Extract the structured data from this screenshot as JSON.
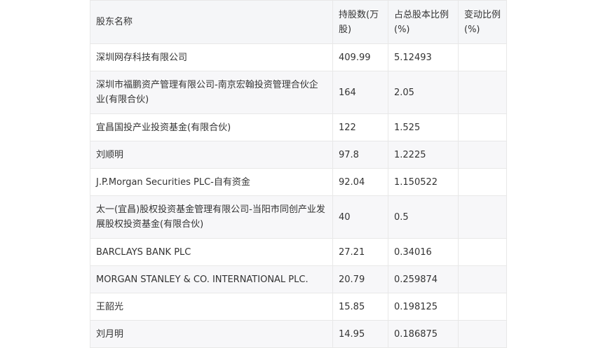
{
  "table": {
    "headers": [
      "股东名称",
      "持股数(万股)",
      "占总股本比例(%)",
      "变动比例(%)"
    ],
    "rows": [
      {
        "name": "深圳网存科技有限公司",
        "shares": "409.99",
        "ratio": "5.12493",
        "change": ""
      },
      {
        "name": "深圳市福鹏资产管理有限公司-南京宏翰投资管理合伙企业(有限合伙)",
        "shares": "164",
        "ratio": "2.05",
        "change": ""
      },
      {
        "name": "宜昌国投产业投资基金(有限合伙)",
        "shares": "122",
        "ratio": "1.525",
        "change": ""
      },
      {
        "name": "刘顺明",
        "shares": "97.8",
        "ratio": "1.2225",
        "change": ""
      },
      {
        "name": "J.P.Morgan Securities PLC-自有资金",
        "shares": "92.04",
        "ratio": "1.150522",
        "change": ""
      },
      {
        "name": "太一(宜昌)股权投资基金管理有限公司-当阳市同创产业发展股权投资基金(有限合伙)",
        "shares": "40",
        "ratio": "0.5",
        "change": ""
      },
      {
        "name": "BARCLAYS BANK PLC",
        "shares": "27.21",
        "ratio": "0.34016",
        "change": ""
      },
      {
        "name": "MORGAN STANLEY & CO. INTERNATIONAL PLC.",
        "shares": "20.79",
        "ratio": "0.259874",
        "change": ""
      },
      {
        "name": "王韶光",
        "shares": "15.85",
        "ratio": "0.198125",
        "change": ""
      },
      {
        "name": "刘月明",
        "shares": "14.95",
        "ratio": "0.186875",
        "change": ""
      }
    ]
  }
}
